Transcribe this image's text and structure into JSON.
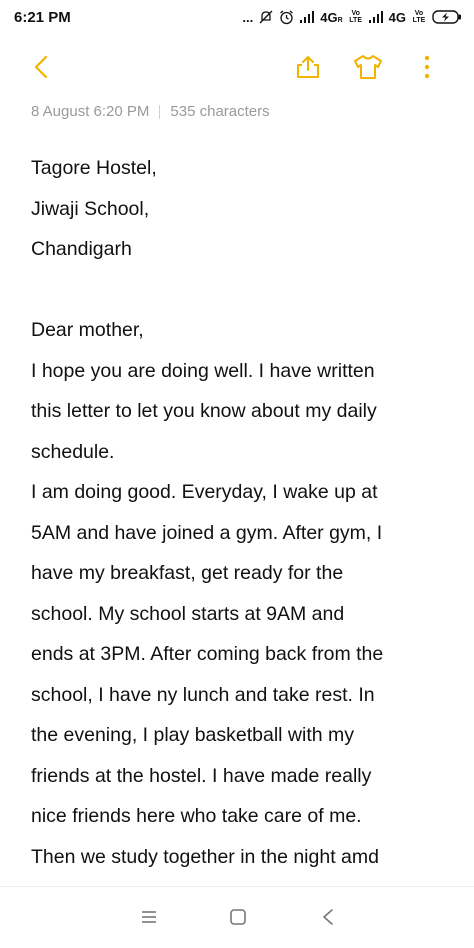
{
  "status_bar": {
    "time": "6:21 PM",
    "dots": "...",
    "net1": "4G",
    "net1_small": "R",
    "volte1": "Vo LTE",
    "net2": "4G",
    "volte2": "Vo LTE"
  },
  "toolbar": {
    "back_icon": "back-chevron-icon",
    "share_icon": "share-icon",
    "theme_icon": "tshirt-icon",
    "more_icon": "more-vertical-icon",
    "accent_color": "#f0b400"
  },
  "note": {
    "date": "8 August  6:20 PM",
    "char_count": "535 characters",
    "address": [
      "Tagore Hostel,",
      "Jiwaji School,",
      "Chandigarh"
    ],
    "body": [
      "Dear mother,",
      "I hope you are doing well. I have written",
      "this letter to let you know about my daily",
      "schedule.",
      "I am doing good. Everyday, I wake up at",
      "5AM and have joined a gym. After gym, I",
      "have my breakfast, get ready for the",
      "school. My school starts at 9AM and",
      "ends at 3PM. After coming back from the",
      "school, I have ny lunch and take rest. In",
      "the evening, I play basketball with my",
      "friends at the hostel. I have made really",
      "nice friends here who take care of me.",
      "Then we study together in the night amd"
    ]
  },
  "nav_bar": {
    "menu_icon": "menu-icon",
    "home_icon": "home-square-icon",
    "back_icon": "back-triangle-icon"
  }
}
